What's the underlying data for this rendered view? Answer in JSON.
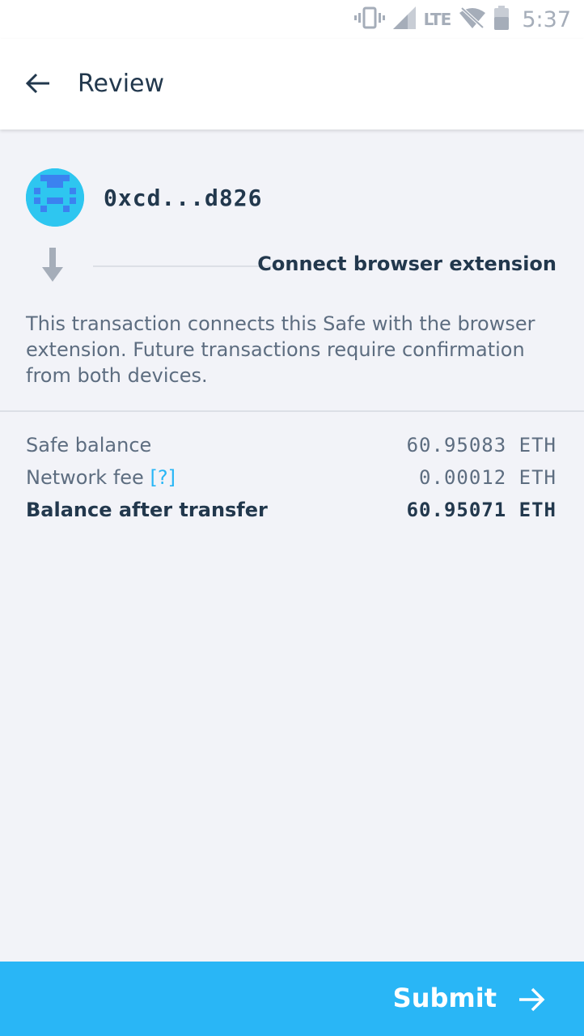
{
  "status_bar": {
    "time": "5:37",
    "network_label": "LTE",
    "icons": [
      "vibrate-icon",
      "signal-icon",
      "lte-icon",
      "wifi-off-icon",
      "battery-icon"
    ]
  },
  "toolbar": {
    "title": "Review",
    "back_icon": "arrow-left-icon"
  },
  "transaction": {
    "address": "0xcd...d826",
    "action_label": "Connect browser extension",
    "description": "This transaction connects this Safe with the browser extension. Future transactions require confirmation from both devices."
  },
  "summary": {
    "rows": [
      {
        "label": "Safe balance",
        "value": "60.95083 ETH"
      },
      {
        "label": "Network fee",
        "help": "[?]",
        "value": "0.00012 ETH"
      },
      {
        "label": "Balance after transfer",
        "value": "60.95071 ETH"
      }
    ]
  },
  "submit": {
    "label": "Submit",
    "icon": "arrow-right-icon"
  },
  "colors": {
    "accent": "#29b6f6",
    "text_dark": "#22384d",
    "text_muted": "#5d6d80",
    "background": "#f2f3f8"
  }
}
